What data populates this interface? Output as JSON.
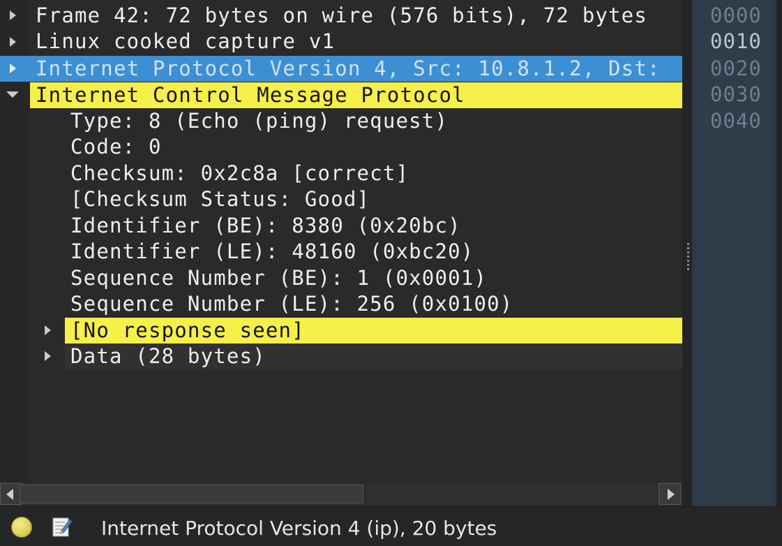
{
  "details": {
    "rows": [
      {
        "text": "Frame 42: 72 bytes on wire (576 bits), 72 bytes",
        "expanded": false
      },
      {
        "text": "Linux cooked capture v1",
        "expanded": false
      },
      {
        "text": "Internet Protocol Version 4, Src: 10.8.1.2, Dst:",
        "expanded": false,
        "selected": true
      },
      {
        "text": "Internet Control Message Protocol",
        "expanded": true,
        "highlight": "yellow"
      },
      {
        "text": "Type: 8 (Echo (ping) request)"
      },
      {
        "text": "Code: 0"
      },
      {
        "text": "Checksum: 0x2c8a [correct]"
      },
      {
        "text": "[Checksum Status: Good]"
      },
      {
        "text": "Identifier (BE): 8380 (0x20bc)"
      },
      {
        "text": "Identifier (LE): 48160 (0xbc20)"
      },
      {
        "text": "Sequence Number (BE): 1 (0x0001)"
      },
      {
        "text": "Sequence Number (LE): 256 (0x0100)"
      },
      {
        "text": "[No response seen]",
        "expanded": false,
        "highlight": "yellow"
      },
      {
        "text": "Data (28 bytes)",
        "expanded": false
      }
    ]
  },
  "bytes": {
    "offsets": [
      "0000",
      "0010",
      "0020",
      "0030",
      "0040"
    ],
    "active_offset": "0010"
  },
  "status": {
    "text": "Internet Protocol Version 4 (ip), 20 bytes",
    "led_color": "#dcd35a"
  },
  "colors": {
    "selection": "#3d8fd3",
    "expert_yellow": "#f7ef4a"
  }
}
